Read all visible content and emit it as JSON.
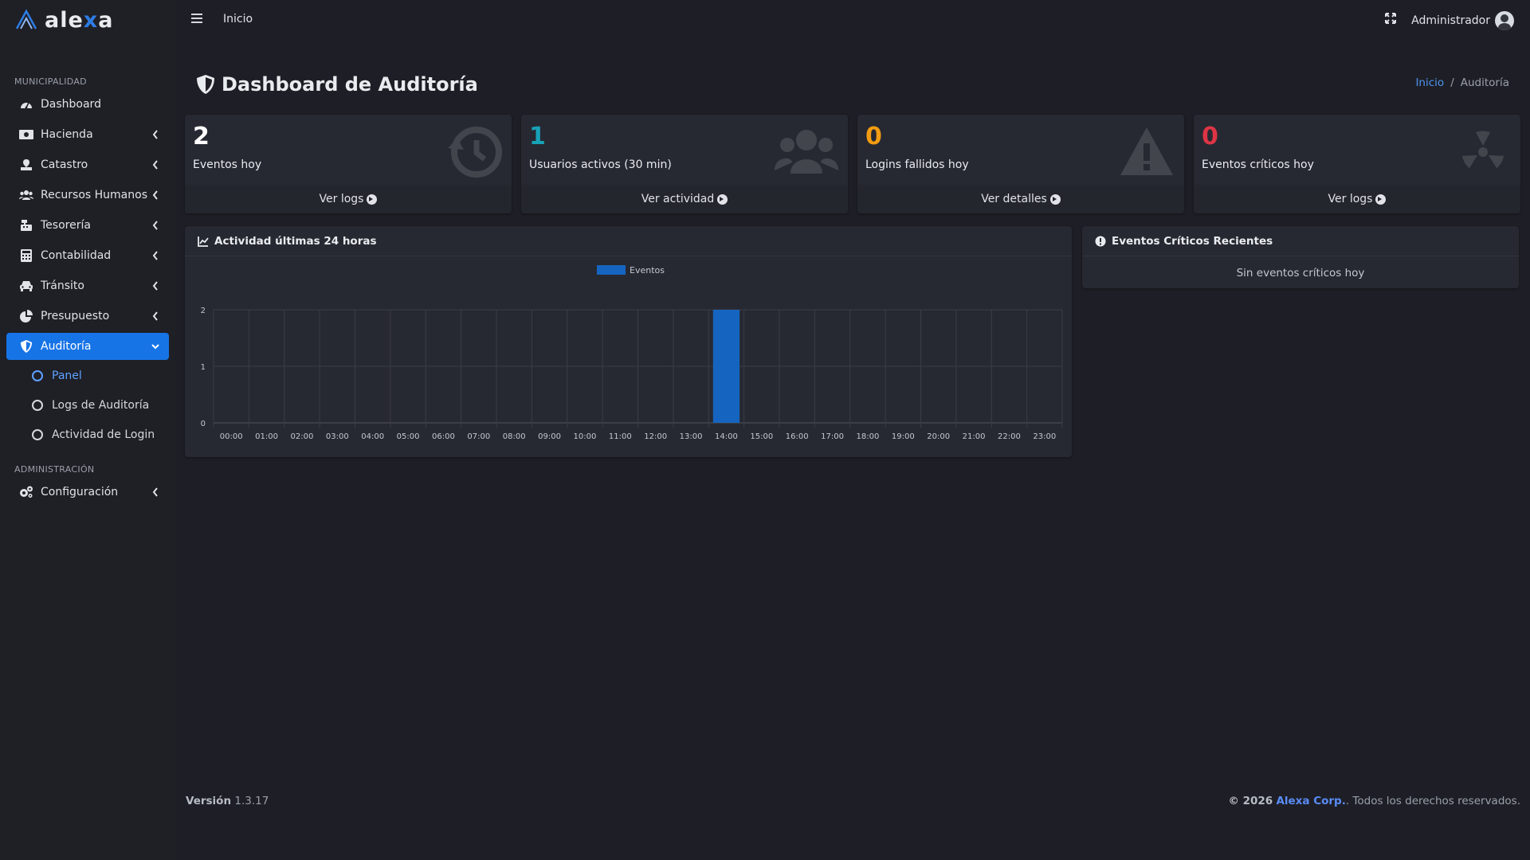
{
  "app": {
    "brand_prefix": "ale",
    "brand_x": "x",
    "brand_suffix": "a"
  },
  "topbar": {
    "home_link": "Inicio",
    "user_name": "Administrador"
  },
  "sidebar": {
    "header_1": "MUNICIPALIDAD",
    "header_2": "ADMINISTRACIÓN",
    "items": [
      {
        "label": "Dashboard",
        "icon": "tachometer-icon"
      },
      {
        "label": "Hacienda",
        "icon": "money-icon"
      },
      {
        "label": "Catastro",
        "icon": "map-icon"
      },
      {
        "label": "Recursos Humanos",
        "icon": "users-icon"
      },
      {
        "label": "Tesorería",
        "icon": "cash-register-icon"
      },
      {
        "label": "Contabilidad",
        "icon": "calculator-icon"
      },
      {
        "label": "Tránsito",
        "icon": "car-icon"
      },
      {
        "label": "Presupuesto",
        "icon": "pie-chart-icon"
      },
      {
        "label": "Auditoría",
        "icon": "shield-icon"
      }
    ],
    "sub_items": [
      {
        "label": "Panel"
      },
      {
        "label": "Logs de Auditoría"
      },
      {
        "label": "Actividad de Login"
      }
    ],
    "admin_items": [
      {
        "label": "Configuración",
        "icon": "cogs-icon"
      }
    ]
  },
  "page": {
    "title": "Dashboard de Auditoría",
    "breadcrumb_home": "Inicio",
    "breadcrumb_sep": "/",
    "breadcrumb_current": "Auditoría"
  },
  "stats": [
    {
      "value": "2",
      "label": "Eventos hoy",
      "link": "Ver logs",
      "color": "#ffffff",
      "icon": "history-icon"
    },
    {
      "value": "1",
      "label": "Usuarios activos (30 min)",
      "link": "Ver actividad",
      "color": "#17a2b8",
      "icon": "users-icon"
    },
    {
      "value": "0",
      "label": "Logins fallidos hoy",
      "link": "Ver detalles",
      "color": "#f39c12",
      "icon": "warning-icon"
    },
    {
      "value": "0",
      "label": "Eventos críticos hoy",
      "link": "Ver logs",
      "color": "#dc3545",
      "icon": "radiation-icon"
    }
  ],
  "activity_card": {
    "title": "Actividad últimas 24 horas"
  },
  "critical_card": {
    "title": "Eventos Críticos Recientes",
    "empty": "Sin eventos críticos hoy"
  },
  "chart_data": {
    "type": "bar",
    "title": "",
    "xlabel": "",
    "ylabel": "",
    "legend": "top",
    "grid": true,
    "ylim": [
      0,
      2
    ],
    "yticks": [
      0,
      1,
      2
    ],
    "categories": [
      "00:00",
      "01:00",
      "02:00",
      "03:00",
      "04:00",
      "05:00",
      "06:00",
      "07:00",
      "08:00",
      "09:00",
      "10:00",
      "11:00",
      "12:00",
      "13:00",
      "14:00",
      "15:00",
      "16:00",
      "17:00",
      "18:00",
      "19:00",
      "20:00",
      "21:00",
      "22:00",
      "23:00"
    ],
    "series": [
      {
        "name": "Eventos",
        "color": "#1565c0",
        "values": [
          0,
          0,
          0,
          0,
          0,
          0,
          0,
          0,
          0,
          0,
          0,
          0,
          0,
          0,
          2,
          0,
          0,
          0,
          0,
          0,
          0,
          0,
          0,
          0
        ]
      }
    ]
  },
  "footer": {
    "version_label": "Versión",
    "version": "1.3.17",
    "copyright": "© 2026",
    "corp": "Alexa Corp.",
    "rights": ". Todos los derechos reservados."
  }
}
